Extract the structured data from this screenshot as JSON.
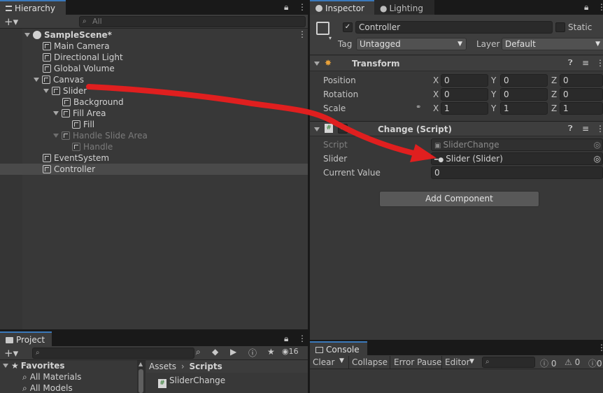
{
  "hierarchy": {
    "tab_label": "Hierarchy",
    "search_placeholder": "All",
    "scene_name": "SampleScene*",
    "items": [
      {
        "label": "Main Camera"
      },
      {
        "label": "Directional Light"
      },
      {
        "label": "Global Volume"
      },
      {
        "label": "Canvas"
      },
      {
        "label": "Slider"
      },
      {
        "label": "Background"
      },
      {
        "label": "Fill Area"
      },
      {
        "label": "Fill"
      },
      {
        "label": "Handle Slide Area"
      },
      {
        "label": "Handle"
      },
      {
        "label": "EventSystem"
      },
      {
        "label": "Controller"
      }
    ]
  },
  "inspector": {
    "tab_label": "Inspector",
    "lighting_tab_label": "Lighting",
    "object_name": "Controller",
    "static_label": "Static",
    "tag_label": "Tag",
    "tag_value": "Untagged",
    "layer_label": "Layer",
    "layer_value": "Default",
    "transform": {
      "title": "Transform",
      "rows": [
        {
          "label": "Position",
          "x": "0",
          "y": "0",
          "z": "0"
        },
        {
          "label": "Rotation",
          "x": "0",
          "y": "0",
          "z": "0"
        },
        {
          "label": "Scale",
          "x": "1",
          "y": "1",
          "z": "1"
        }
      ],
      "axis_x": "X",
      "axis_y": "Y",
      "axis_z": "Z"
    },
    "script_component": {
      "title": "Slider Change (Script)",
      "title_visible": "Change (Script)",
      "script_label": "Script",
      "script_value": "SliderChange",
      "slider_label": "Slider",
      "slider_value": "Slider (Slider)",
      "current_value_label": "Current Value",
      "current_value": "0"
    },
    "add_component_label": "Add Component"
  },
  "project": {
    "tab_label": "Project",
    "favorites_label": "Favorites",
    "favorites_items": [
      "All Materials",
      "All Models"
    ],
    "breadcrumb_root": "Assets",
    "breadcrumb_current": "Scripts",
    "files": [
      "SliderChange"
    ],
    "hidden_count": "16"
  },
  "console": {
    "tab_label": "Console",
    "clear_label": "Clear",
    "collapse_label": "Collapse",
    "error_pause_label": "Error Pause",
    "editor_label": "Editor",
    "info_count": "0",
    "warning_count": "0",
    "error_count": "0"
  },
  "colors": {
    "accent": "#3a79bb",
    "arrow": "#e01f1f"
  }
}
